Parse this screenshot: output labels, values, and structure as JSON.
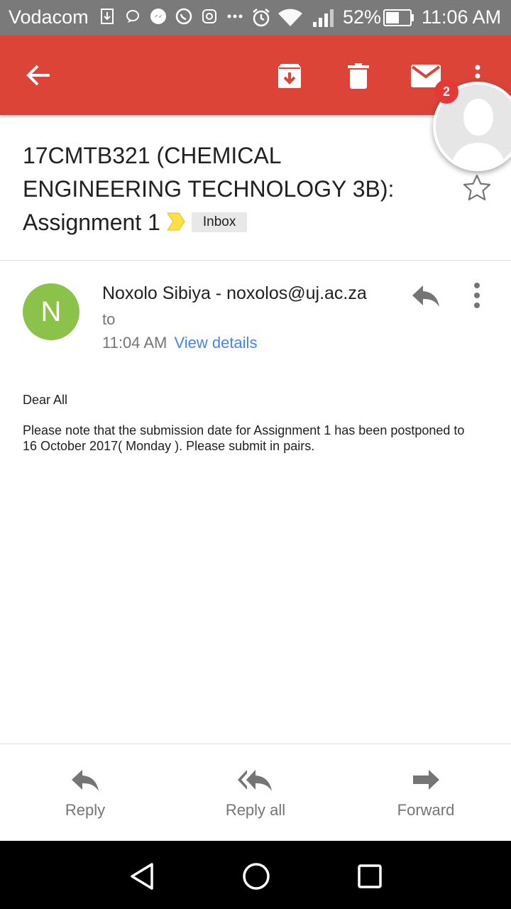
{
  "status_bar": {
    "carrier": "Vodacom",
    "battery_percent": "52%",
    "time": "11:06 AM"
  },
  "app_bar": {
    "icons": [
      "back-arrow-icon",
      "archive-icon",
      "trash-icon",
      "mail-icon",
      "more-vert-icon"
    ]
  },
  "chat_head": {
    "badge_count": "2"
  },
  "email": {
    "subject": "17CMTB321 (CHEMICAL ENGINEERING TECHNOLOGY 3B): Assignment 1",
    "label": "Inbox",
    "sender_initial": "N",
    "sender": "Noxolo Sibiya - noxolos@uj.ac.za",
    "recipient_prefix": "to",
    "time": "11:04 AM",
    "view_details": "View details",
    "greeting": "Dear All",
    "body": "Please note that the submission  date for Assignment 1 has been postponed to  16 October 2017( Monday ). Please submit in pairs."
  },
  "actions": {
    "reply": "Reply",
    "reply_all": "Reply all",
    "forward": "Forward"
  },
  "colors": {
    "app_bar": "#db4437",
    "status_bar": "#7a7a7a",
    "avatar": "#8bc34a",
    "link": "#4285f4",
    "badge": "#e53935"
  }
}
